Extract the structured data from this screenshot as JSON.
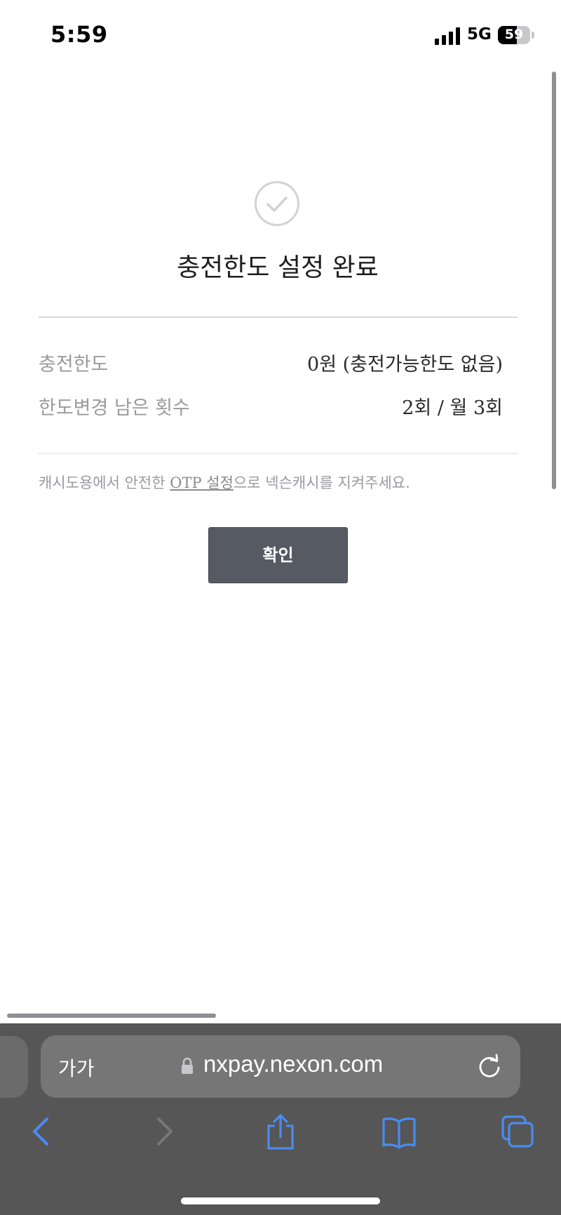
{
  "status_bar": {
    "time": "5:59",
    "network": "5G",
    "battery": "59",
    "battery_level": 0.59
  },
  "result": {
    "title": "충전한도 설정 완료",
    "rows": [
      {
        "label": "충전한도",
        "value": "0원 (충전가능한도 없음)"
      },
      {
        "label": "한도변경 남은 횟수",
        "value": "2회 / 월 3회"
      }
    ],
    "notice_prefix": "캐시도용에서 안전한 ",
    "notice_link": "OTP 설정",
    "notice_suffix": "으로 넥슨캐시를 지켜주세요.",
    "confirm_label": "확인"
  },
  "browser": {
    "text_size_label": "가가",
    "domain": "nxpay.nexon.com"
  },
  "colors": {
    "accent_blue": "#3b82f6",
    "button_bg": "#555a63",
    "toolbar_bg": "#565656"
  },
  "icons": [
    "check-icon",
    "lock-icon",
    "reload-icon",
    "back-icon",
    "forward-icon",
    "share-icon",
    "bookmarks-icon",
    "tabs-icon"
  ]
}
